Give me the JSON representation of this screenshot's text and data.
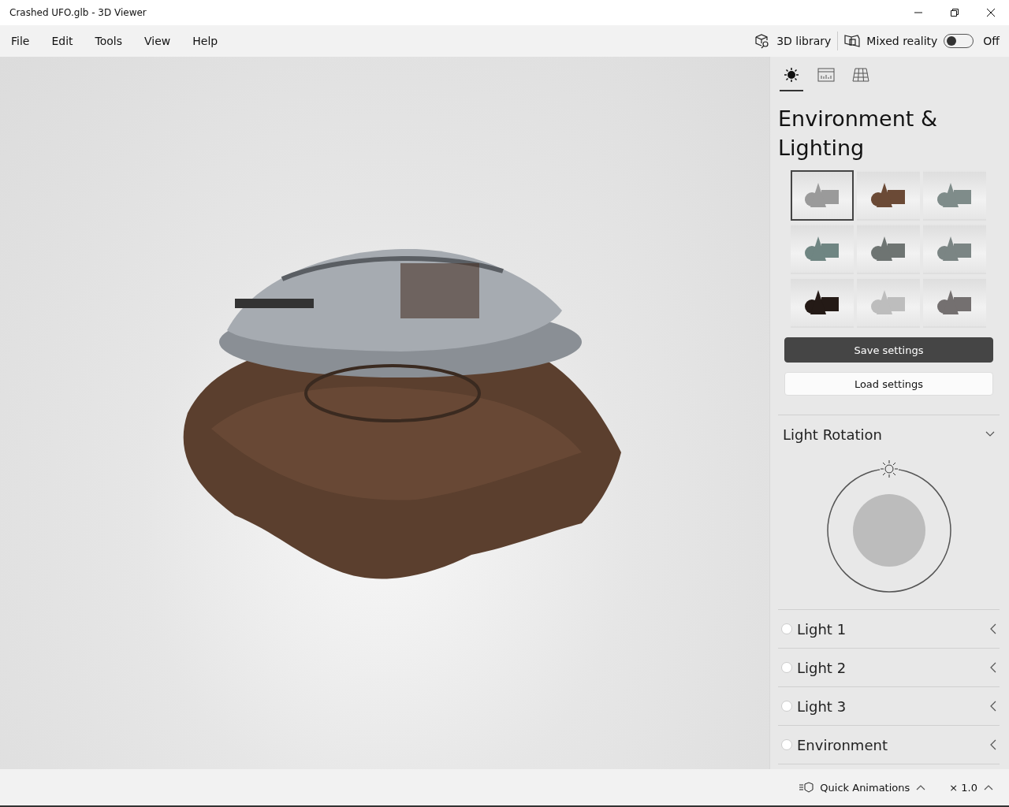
{
  "window": {
    "title": "Crashed UFO.glb - 3D Viewer"
  },
  "menu": [
    "File",
    "Edit",
    "Tools",
    "View",
    "Help"
  ],
  "toolbar": {
    "library": "3D library",
    "mixed_reality": {
      "label": "Mixed reality",
      "on": false,
      "state_text": "Off"
    }
  },
  "panel": {
    "tabs": [
      {
        "kind": "lighting",
        "selected": true
      },
      {
        "kind": "stats",
        "selected": false
      },
      {
        "kind": "grid",
        "selected": false
      }
    ],
    "title": "Environment & Lighting",
    "environments": [
      {
        "color": "#9a9a9a",
        "selected": true
      },
      {
        "color": "#6b4a36",
        "selected": false
      },
      {
        "color": "#7f8c8a",
        "selected": false
      },
      {
        "color": "#6f8582",
        "selected": false
      },
      {
        "color": "#6e7472",
        "selected": false
      },
      {
        "color": "#7b8584",
        "selected": false
      },
      {
        "color": "#241a16",
        "selected": false
      },
      {
        "color": "#bdbdbd",
        "selected": false
      },
      {
        "color": "#747070",
        "selected": false
      }
    ],
    "buttons": [
      {
        "kind": "primary",
        "label": "Save settings"
      },
      {
        "kind": "secondary",
        "label": "Load settings"
      }
    ],
    "light_rotation": {
      "title": "Light Rotation",
      "expanded": true
    },
    "lights": [
      {
        "label": "Light 1",
        "checked": false
      },
      {
        "label": "Light 2",
        "checked": false
      },
      {
        "label": "Light 3",
        "checked": false
      },
      {
        "label": "Environment",
        "checked": false
      }
    ]
  },
  "status_bar": {
    "animations": "Quick Animations",
    "speed": "× 1.0"
  }
}
